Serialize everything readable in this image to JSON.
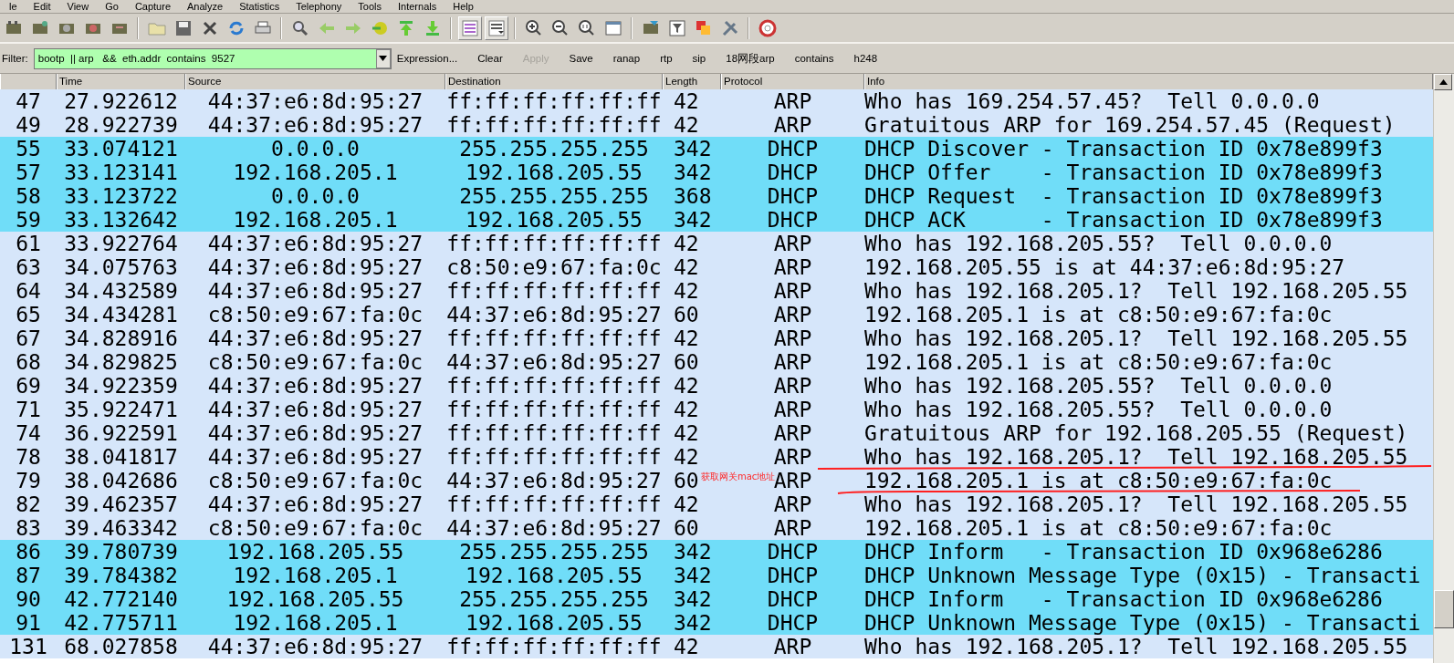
{
  "menu": [
    "le",
    "Edit",
    "View",
    "Go",
    "Capture",
    "Analyze",
    "Statistics",
    "Telephony",
    "Tools",
    "Internals",
    "Help"
  ],
  "filter": {
    "label": "Filter:",
    "value": "bootp  || arp   &&  eth.addr  contains  9527"
  },
  "filter_buttons": [
    {
      "label": "Expression...",
      "disabled": false
    },
    {
      "label": "Clear",
      "disabled": false
    },
    {
      "label": "Apply",
      "disabled": true
    },
    {
      "label": "Save",
      "disabled": false
    },
    {
      "label": "ranap",
      "disabled": false
    },
    {
      "label": "rtp",
      "disabled": false
    },
    {
      "label": "sip",
      "disabled": false
    },
    {
      "label": "18网段arp",
      "disabled": false
    },
    {
      "label": "contains",
      "disabled": false
    },
    {
      "label": "h248",
      "disabled": false
    }
  ],
  "columns": [
    "Time",
    "Source",
    "Destination",
    "Length",
    "Protocol",
    "Info"
  ],
  "rows": [
    {
      "no": "47",
      "time": "27.922612",
      "source": "44:37:e6:8d:95:27",
      "destination": "ff:ff:ff:ff:ff:ff",
      "length": "42",
      "protocol": "ARP",
      "info": "Who has 169.254.57.45?  Tell 0.0.0.0",
      "color": "#d6e6fa"
    },
    {
      "no": "49",
      "time": "28.922739",
      "source": "44:37:e6:8d:95:27",
      "destination": "ff:ff:ff:ff:ff:ff",
      "length": "42",
      "protocol": "ARP",
      "info": "Gratuitous ARP for 169.254.57.45 (Request)",
      "color": "#d6e6fa"
    },
    {
      "no": "55",
      "time": "33.074121",
      "source": "0.0.0.0",
      "destination": "255.255.255.255",
      "length": "342",
      "protocol": "DHCP",
      "info": "DHCP Discover - Transaction ID 0x78e899f3",
      "color": "#70ddf8"
    },
    {
      "no": "57",
      "time": "33.123141",
      "source": "192.168.205.1",
      "destination": "192.168.205.55",
      "length": "342",
      "protocol": "DHCP",
      "info": "DHCP Offer    - Transaction ID 0x78e899f3",
      "color": "#70ddf8"
    },
    {
      "no": "58",
      "time": "33.123722",
      "source": "0.0.0.0",
      "destination": "255.255.255.255",
      "length": "368",
      "protocol": "DHCP",
      "info": "DHCP Request  - Transaction ID 0x78e899f3",
      "color": "#70ddf8"
    },
    {
      "no": "59",
      "time": "33.132642",
      "source": "192.168.205.1",
      "destination": "192.168.205.55",
      "length": "342",
      "protocol": "DHCP",
      "info": "DHCP ACK      - Transaction ID 0x78e899f3",
      "color": "#70ddf8"
    },
    {
      "no": "61",
      "time": "33.922764",
      "source": "44:37:e6:8d:95:27",
      "destination": "ff:ff:ff:ff:ff:ff",
      "length": "42",
      "protocol": "ARP",
      "info": "Who has 192.168.205.55?  Tell 0.0.0.0",
      "color": "#d6e6fa"
    },
    {
      "no": "63",
      "time": "34.075763",
      "source": "44:37:e6:8d:95:27",
      "destination": "c8:50:e9:67:fa:0c",
      "length": "42",
      "protocol": "ARP",
      "info": "192.168.205.55 is at 44:37:e6:8d:95:27",
      "color": "#d6e6fa"
    },
    {
      "no": "64",
      "time": "34.432589",
      "source": "44:37:e6:8d:95:27",
      "destination": "ff:ff:ff:ff:ff:ff",
      "length": "42",
      "protocol": "ARP",
      "info": "Who has 192.168.205.1?  Tell 192.168.205.55",
      "color": "#d6e6fa"
    },
    {
      "no": "65",
      "time": "34.434281",
      "source": "c8:50:e9:67:fa:0c",
      "destination": "44:37:e6:8d:95:27",
      "length": "60",
      "protocol": "ARP",
      "info": "192.168.205.1 is at c8:50:e9:67:fa:0c",
      "color": "#d6e6fa"
    },
    {
      "no": "67",
      "time": "34.828916",
      "source": "44:37:e6:8d:95:27",
      "destination": "ff:ff:ff:ff:ff:ff",
      "length": "42",
      "protocol": "ARP",
      "info": "Who has 192.168.205.1?  Tell 192.168.205.55",
      "color": "#d6e6fa"
    },
    {
      "no": "68",
      "time": "34.829825",
      "source": "c8:50:e9:67:fa:0c",
      "destination": "44:37:e6:8d:95:27",
      "length": "60",
      "protocol": "ARP",
      "info": "192.168.205.1 is at c8:50:e9:67:fa:0c",
      "color": "#d6e6fa"
    },
    {
      "no": "69",
      "time": "34.922359",
      "source": "44:37:e6:8d:95:27",
      "destination": "ff:ff:ff:ff:ff:ff",
      "length": "42",
      "protocol": "ARP",
      "info": "Who has 192.168.205.55?  Tell 0.0.0.0",
      "color": "#d6e6fa"
    },
    {
      "no": "71",
      "time": "35.922471",
      "source": "44:37:e6:8d:95:27",
      "destination": "ff:ff:ff:ff:ff:ff",
      "length": "42",
      "protocol": "ARP",
      "info": "Who has 192.168.205.55?  Tell 0.0.0.0",
      "color": "#d6e6fa"
    },
    {
      "no": "74",
      "time": "36.922591",
      "source": "44:37:e6:8d:95:27",
      "destination": "ff:ff:ff:ff:ff:ff",
      "length": "42",
      "protocol": "ARP",
      "info": "Gratuitous ARP for 192.168.205.55 (Request)",
      "color": "#d6e6fa"
    },
    {
      "no": "78",
      "time": "38.041817",
      "source": "44:37:e6:8d:95:27",
      "destination": "ff:ff:ff:ff:ff:ff",
      "length": "42",
      "protocol": "ARP",
      "info": "Who has 192.168.205.1?  Tell 192.168.205.55",
      "color": "#d6e6fa"
    },
    {
      "no": "79",
      "time": "38.042686",
      "source": "c8:50:e9:67:fa:0c",
      "destination": "44:37:e6:8d:95:27",
      "length": "60",
      "protocol": "ARP",
      "info": "192.168.205.1 is at c8:50:e9:67:fa:0c",
      "color": "#d6e6fa",
      "note": "获取网关mac地址"
    },
    {
      "no": "82",
      "time": "39.462357",
      "source": "44:37:e6:8d:95:27",
      "destination": "ff:ff:ff:ff:ff:ff",
      "length": "42",
      "protocol": "ARP",
      "info": "Who has 192.168.205.1?  Tell 192.168.205.55",
      "color": "#d6e6fa"
    },
    {
      "no": "83",
      "time": "39.463342",
      "source": "c8:50:e9:67:fa:0c",
      "destination": "44:37:e6:8d:95:27",
      "length": "60",
      "protocol": "ARP",
      "info": "192.168.205.1 is at c8:50:e9:67:fa:0c",
      "color": "#d6e6fa"
    },
    {
      "no": "86",
      "time": "39.780739",
      "source": "192.168.205.55",
      "destination": "255.255.255.255",
      "length": "342",
      "protocol": "DHCP",
      "info": "DHCP Inform   - Transaction ID 0x968e6286",
      "color": "#70ddf8"
    },
    {
      "no": "87",
      "time": "39.784382",
      "source": "192.168.205.1",
      "destination": "192.168.205.55",
      "length": "342",
      "protocol": "DHCP",
      "info": "DHCP Unknown Message Type (0x15) - Transacti",
      "color": "#70ddf8"
    },
    {
      "no": "90",
      "time": "42.772140",
      "source": "192.168.205.55",
      "destination": "255.255.255.255",
      "length": "342",
      "protocol": "DHCP",
      "info": "DHCP Inform   - Transaction ID 0x968e6286",
      "color": "#70ddf8"
    },
    {
      "no": "91",
      "time": "42.775711",
      "source": "192.168.205.1",
      "destination": "192.168.205.55",
      "length": "342",
      "protocol": "DHCP",
      "info": "DHCP Unknown Message Type (0x15) - Transacti",
      "color": "#70ddf8"
    },
    {
      "no": "131",
      "time": "68.027858",
      "source": "44:37:e6:8d:95:27",
      "destination": "ff:ff:ff:ff:ff:ff",
      "length": "42",
      "protocol": "ARP",
      "info": "Who has 192.168.205.1?  Tell 192.168.205.55",
      "color": "#d6e6fa"
    }
  ]
}
